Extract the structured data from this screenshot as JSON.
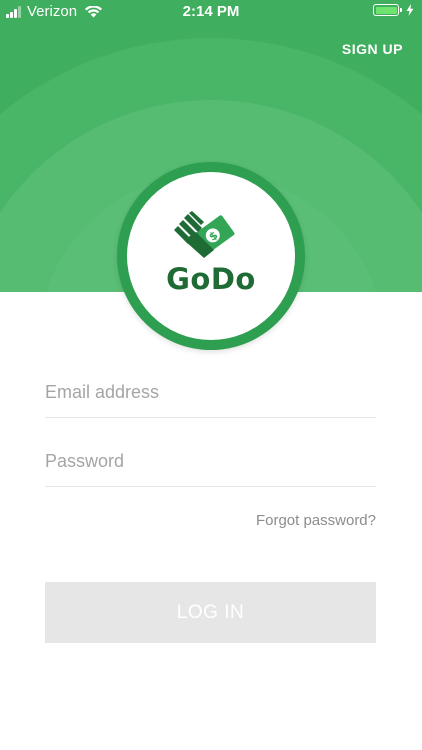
{
  "status_bar": {
    "carrier": "Verizon",
    "time": "2:14 PM"
  },
  "header": {
    "signup_label": "SIGN UP"
  },
  "logo": {
    "brand_name": "GoDo",
    "icon": "hand-money-icon"
  },
  "form": {
    "email_placeholder": "Email address",
    "email_value": "",
    "password_placeholder": "Password",
    "password_value": "",
    "forgot_label": "Forgot password?",
    "login_label": "LOG IN"
  },
  "colors": {
    "brand_green": "#3fae5e",
    "brand_dark_green": "#1f6b35",
    "button_disabled": "#e6e6e6"
  }
}
